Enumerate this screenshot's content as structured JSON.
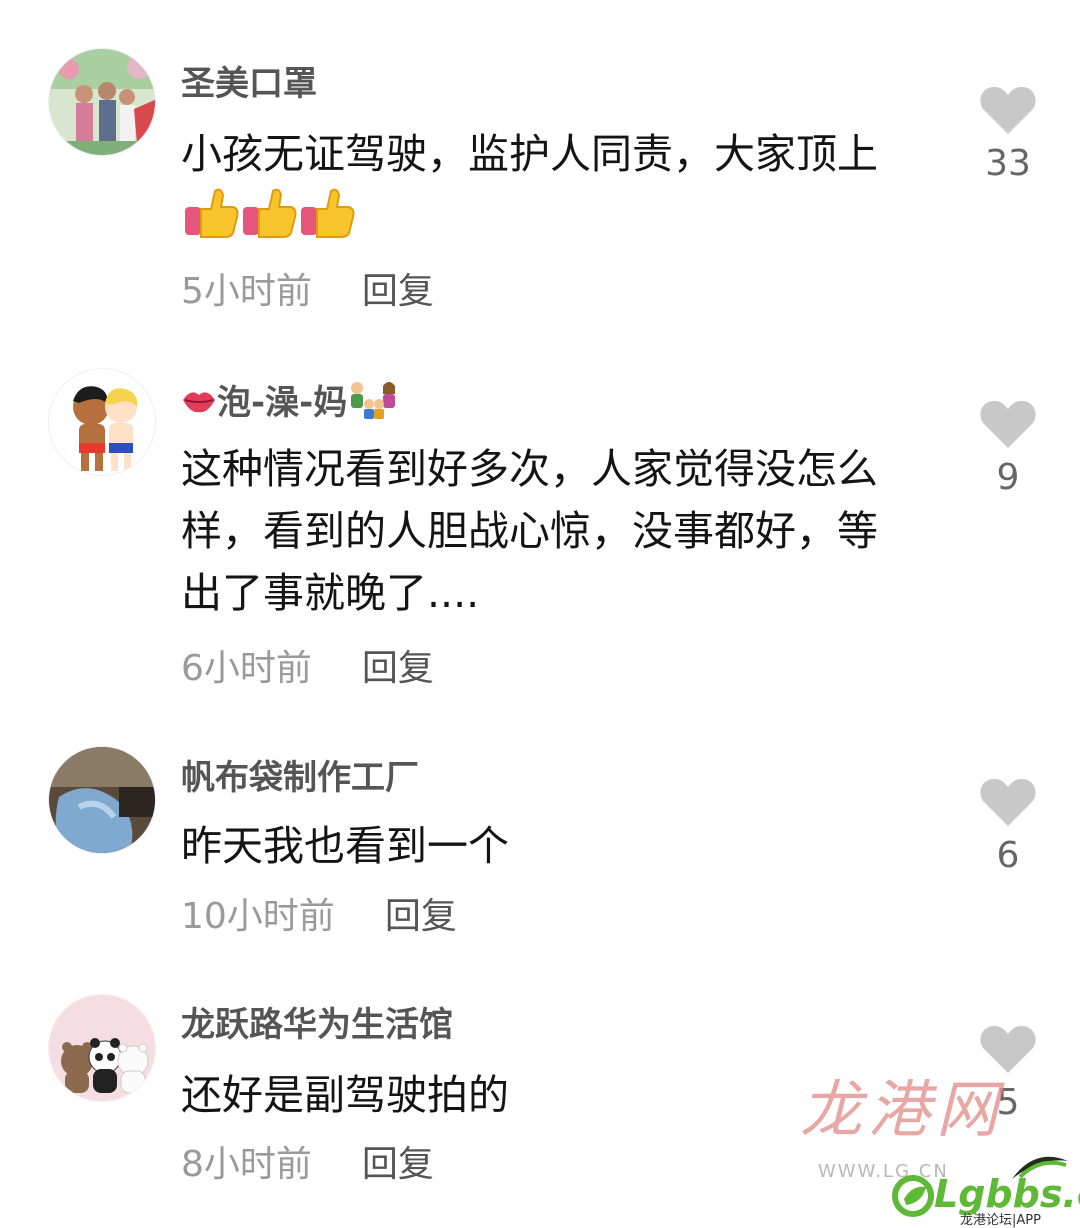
{
  "comments": [
    {
      "username": "圣美口罩",
      "text": "小孩无证驾驶，监护人同责，大家顶上",
      "time": "5小时前",
      "reply": "回复",
      "likes": "33",
      "avatar_icon": "family-photo-avatar"
    },
    {
      "username": "泡-澡-妈",
      "username_prefix_icon": "kiss-lips-emoji",
      "username_suffix_icon": "family-emoji",
      "text": "这种情况看到好多次，人家觉得没怎么样，看到的人胆战心惊，没事都好，等出了事就晚了....",
      "time": "6小时前",
      "reply": "回复",
      "likes": "9",
      "avatar_icon": "cartoon-kids-avatar"
    },
    {
      "username": "帆布袋制作工厂",
      "text": "昨天我也看到一个",
      "time": "10小时前",
      "reply": "回复",
      "likes": "6",
      "avatar_icon": "fabric-photo-avatar"
    },
    {
      "username": "龙跃路华为生活馆",
      "text": "还好是副驾驶拍的",
      "time": "8小时前",
      "reply": "回复",
      "likes": "5",
      "avatar_icon": "three-bears-avatar"
    }
  ],
  "watermark": {
    "brand_script": "龙港网",
    "site_small": "WWW.LG.CN",
    "logo_text": "Lgbbs.cn",
    "logo_sub": "龙港论坛|APP"
  },
  "colors": {
    "username": "#555555",
    "time": "#9a9a9a",
    "heart": "#c8c8c8",
    "watermark_red": "#e08a86",
    "logo_green": "#5fb836"
  }
}
